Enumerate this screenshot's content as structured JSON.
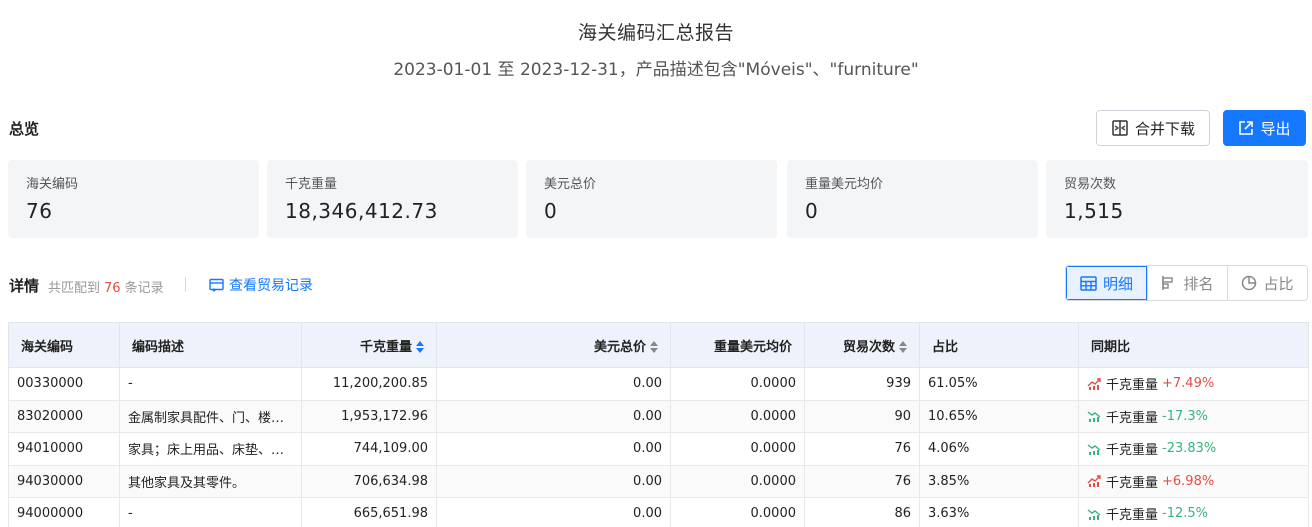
{
  "report": {
    "title": "海关编码汇总报告",
    "subtitle": "2023-01-01 至 2023-12-31，产品描述包含\"Móveis\"、\"furniture\""
  },
  "overview": {
    "title": "总览",
    "merge_download_label": "合并下载",
    "export_label": "导出",
    "stats": [
      {
        "label": "海关编码",
        "value": "76"
      },
      {
        "label": "千克重量",
        "value": "18,346,412.73"
      },
      {
        "label": "美元总价",
        "value": "0"
      },
      {
        "label": "重量美元均价",
        "value": "0"
      },
      {
        "label": "贸易次数",
        "value": "1,515"
      }
    ]
  },
  "details": {
    "title": "详情",
    "count_prefix": "共匹配到",
    "count": "76",
    "count_suffix": "条记录",
    "trade_link": "查看贸易记录",
    "views": [
      {
        "label": "明细",
        "icon": "table-icon",
        "active": true
      },
      {
        "label": "排名",
        "icon": "bar-rank-icon",
        "active": false
      },
      {
        "label": "占比",
        "icon": "pie-icon",
        "active": false
      }
    ]
  },
  "table": {
    "columns": [
      "海关编码",
      "编码描述",
      "千克重量",
      "美元总价",
      "重量美元均价",
      "贸易次数",
      "占比",
      "同期比"
    ],
    "rows": [
      {
        "code": "00330000",
        "desc": "-",
        "weight": "11,200,200.85",
        "usd": "0.00",
        "avg": "0.0000",
        "trades": "939",
        "share": "61.05%",
        "yoy_label": "千克重量",
        "yoy_value": "+7.49%",
        "trend": "up"
      },
      {
        "code": "83020000",
        "desc": "金属制家具配件、门、楼梯、窗等",
        "weight": "1,953,172.96",
        "usd": "0.00",
        "avg": "0.0000",
        "trades": "90",
        "share": "10.65%",
        "yoy_label": "千克重量",
        "yoy_value": "-17.3%",
        "trend": "down"
      },
      {
        "code": "94010000",
        "desc": "家具；床上用品、床垫、床架",
        "weight": "744,109.00",
        "usd": "0.00",
        "avg": "0.0000",
        "trades": "76",
        "share": "4.06%",
        "yoy_label": "千克重量",
        "yoy_value": "-23.83%",
        "trend": "down"
      },
      {
        "code": "94030000",
        "desc": "其他家具及其零件。",
        "weight": "706,634.98",
        "usd": "0.00",
        "avg": "0.0000",
        "trades": "76",
        "share": "3.85%",
        "yoy_label": "千克重量",
        "yoy_value": "+6.98%",
        "trend": "up"
      },
      {
        "code": "94000000",
        "desc": "-",
        "weight": "665,651.98",
        "usd": "0.00",
        "avg": "0.0000",
        "trades": "86",
        "share": "3.63%",
        "yoy_label": "千克重量",
        "yoy_value": "-12.5%",
        "trend": "down"
      }
    ]
  },
  "colors": {
    "accent": "#1677ff",
    "up": "#e54d42",
    "down": "#36b37e"
  }
}
